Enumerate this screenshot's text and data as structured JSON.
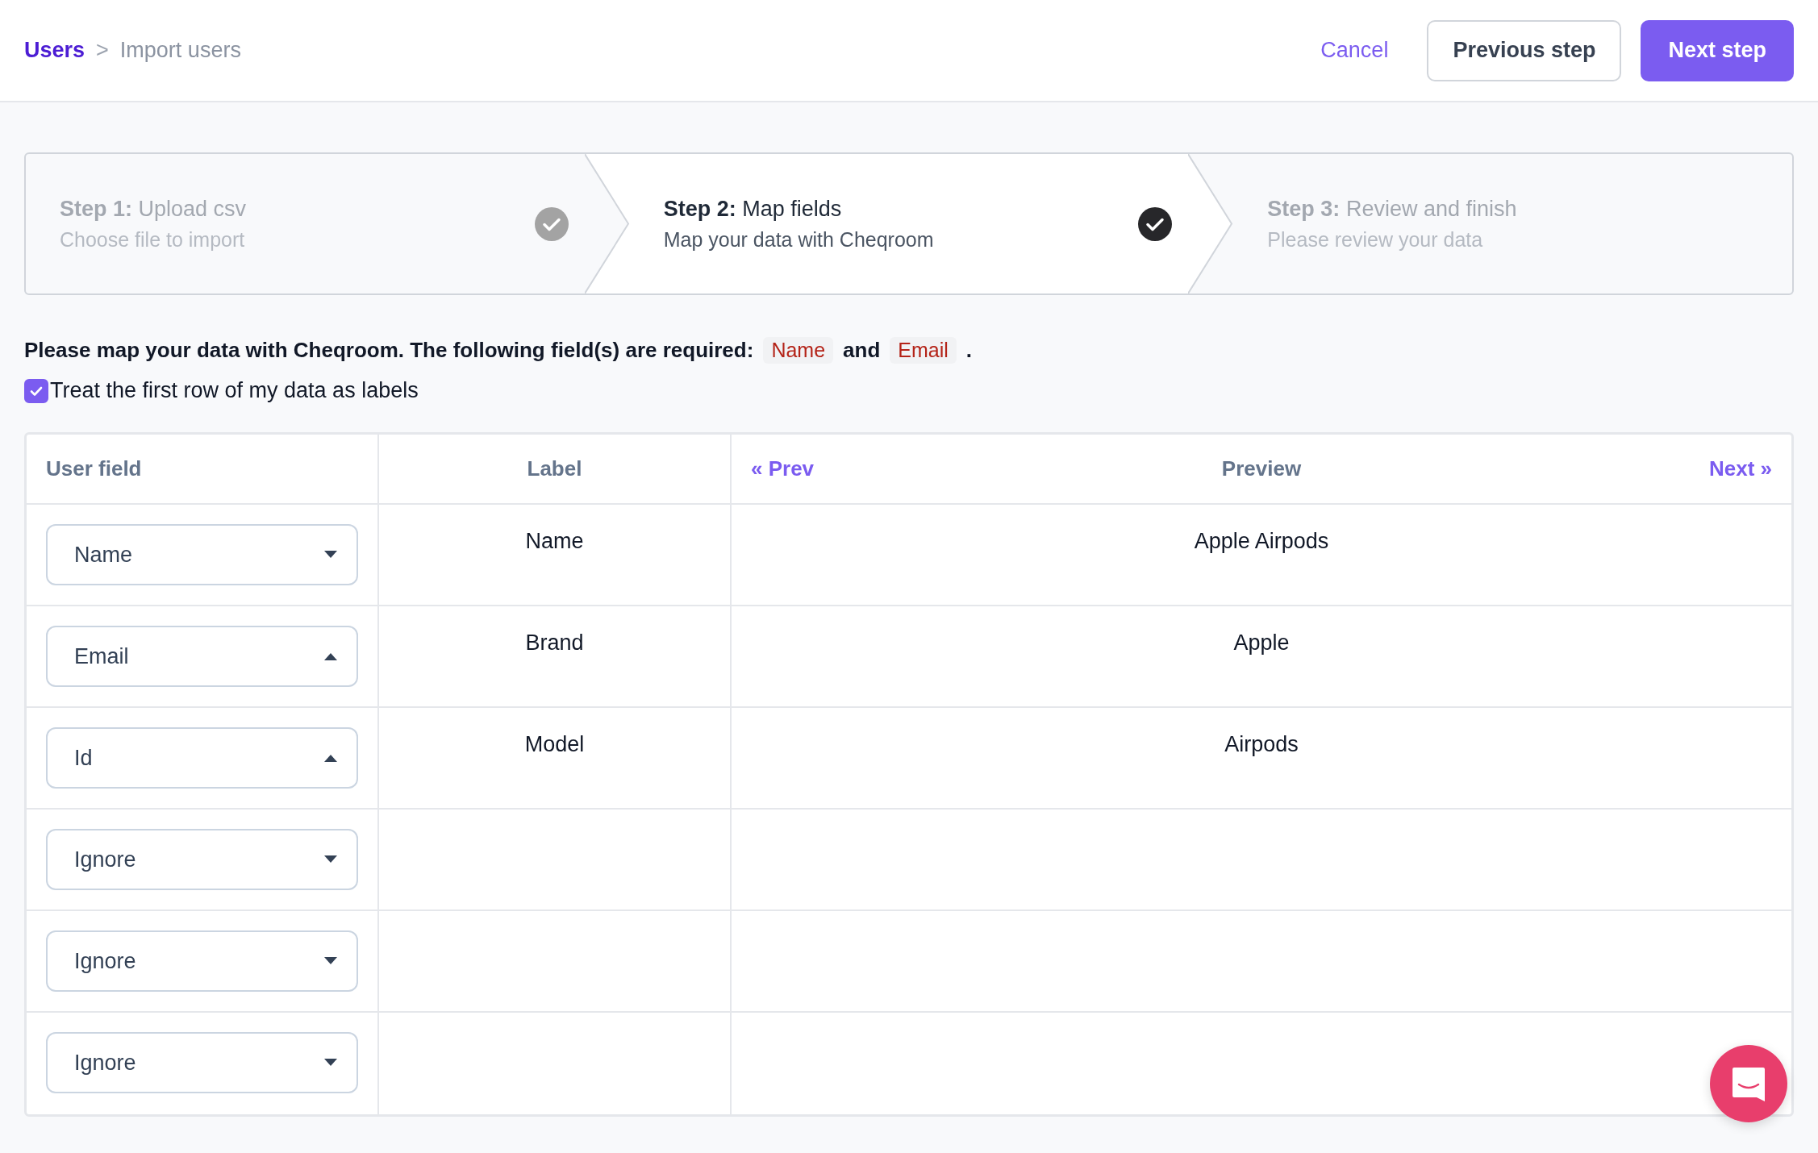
{
  "breadcrumb": {
    "parent": "Users",
    "separator": ">",
    "current": "Import users"
  },
  "actions": {
    "cancel": "Cancel",
    "previous": "Previous step",
    "next": "Next step"
  },
  "steps": [
    {
      "number": "Step 1:",
      "title": "Upload csv",
      "subtitle": "Choose file to import",
      "selected": false,
      "completed": true
    },
    {
      "number": "Step 2:",
      "title": "Map fields",
      "subtitle": "Map your data with Cheqroom",
      "selected": true,
      "completed": true
    },
    {
      "number": "Step 3:",
      "title": "Review and finish",
      "subtitle": "Please review your data",
      "selected": false,
      "completed": false
    }
  ],
  "instruction": {
    "text": "Please map your data with Cheqroom. The following field(s) are required:",
    "required": [
      "Name",
      "Email"
    ],
    "conjunction": "and",
    "end": "."
  },
  "first_row_labels": {
    "label": "Treat the first row of my data as labels",
    "checked": true
  },
  "table": {
    "columns": {
      "user_field": "User field",
      "label": "Label",
      "prev": "« Prev",
      "preview": "Preview",
      "next": "Next »"
    },
    "rows": [
      {
        "field": "Name",
        "expanded": false,
        "label": "Name",
        "preview": "Apple Airpods"
      },
      {
        "field": "Email",
        "expanded": true,
        "label": "Brand",
        "preview": "Apple"
      },
      {
        "field": "Id",
        "expanded": true,
        "label": "Model",
        "preview": "Airpods"
      },
      {
        "field": "Ignore",
        "expanded": false
      },
      {
        "field": "Ignore",
        "expanded": false
      },
      {
        "field": "Ignore",
        "expanded": false
      }
    ]
  }
}
